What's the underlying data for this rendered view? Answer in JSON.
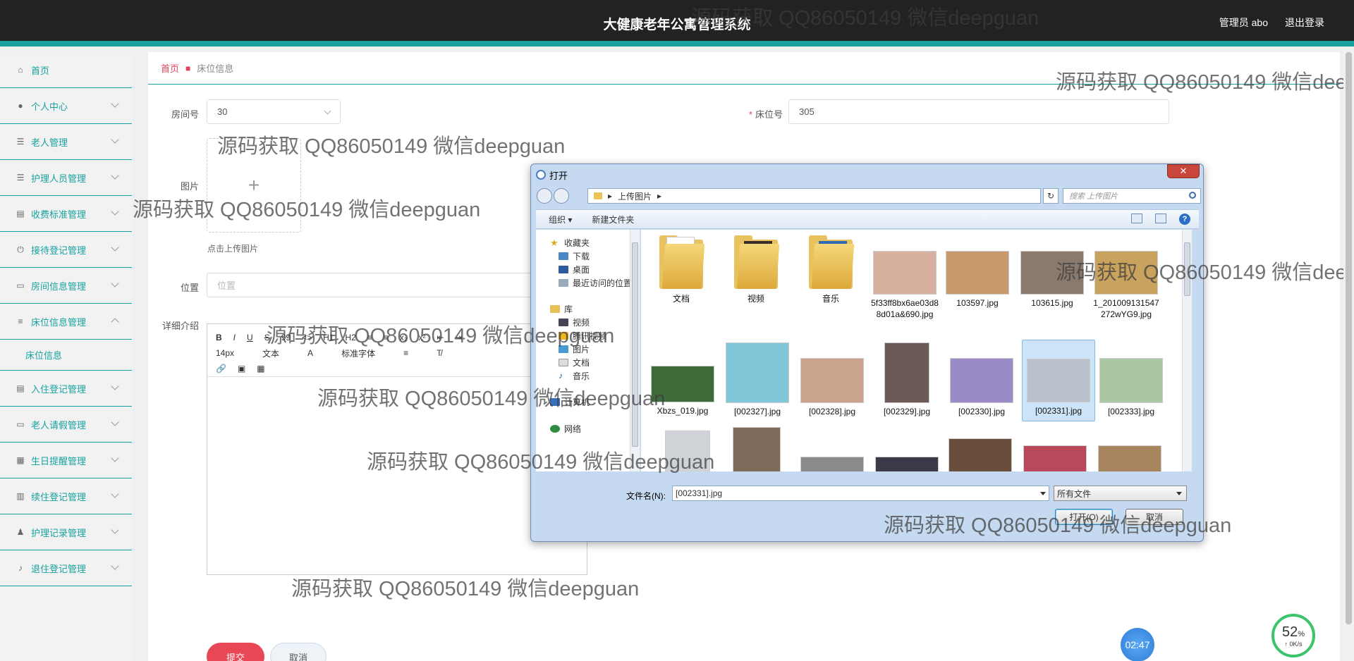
{
  "header": {
    "title": "大健康老年公寓管理系统",
    "user": "管理员 abo",
    "logout": "退出登录"
  },
  "sidebar": {
    "items": [
      {
        "label": "首页",
        "icon": "home-icon"
      },
      {
        "label": "个人中心",
        "icon": "user-icon"
      },
      {
        "label": "老人管理",
        "icon": "list-icon"
      },
      {
        "label": "护理人员管理",
        "icon": "list-icon"
      },
      {
        "label": "收费标准管理",
        "icon": "clipboard-icon"
      },
      {
        "label": "接待登记管理",
        "icon": "power-icon"
      },
      {
        "label": "房间信息管理",
        "icon": "monitor-icon"
      },
      {
        "label": "床位信息管理",
        "icon": "sliders-icon",
        "expanded": true
      },
      {
        "label": "入住登记管理",
        "icon": "clipboard-icon"
      },
      {
        "label": "老人请假管理",
        "icon": "monitor-icon"
      },
      {
        "label": "生日提醒管理",
        "icon": "grid-icon"
      },
      {
        "label": "续住登记管理",
        "icon": "bar-chart-icon"
      },
      {
        "label": "护理记录管理",
        "icon": "person-icon"
      },
      {
        "label": "退住登记管理",
        "icon": "mic-icon"
      }
    ],
    "sub": "床位信息"
  },
  "breadcrumb": {
    "home": "首页",
    "current": "床位信息"
  },
  "form": {
    "room_label": "房间号",
    "room_value": "30",
    "bed_label": "床位号",
    "bed_value": "305",
    "image_label": "图片",
    "upload_tip": "点击上传图片",
    "position_label": "位置",
    "position_placeholder": "位置",
    "detail_label": "详细介绍",
    "submit": "提交",
    "cancel": "取消"
  },
  "editor": {
    "row1": [
      "B",
      "I",
      "U",
      "S",
      "99",
      "<>",
      "H1",
      "H2",
      "≡",
      "≡",
      "x₂",
      "x²",
      "⇤",
      "⇥"
    ],
    "font_size": "14px",
    "text_style": "文本",
    "font_family": "标准字体"
  },
  "dialog": {
    "title": "打开",
    "path": "上传图片",
    "search_placeholder": "搜索 上传图片",
    "organize": "组织 ▾",
    "new_folder": "新建文件夹",
    "nav": [
      "收藏夹",
      "下载",
      "桌面",
      "最近访问的位置",
      "库",
      "视频",
      "腾讯视频",
      "图片",
      "文档",
      "音乐",
      "计算机",
      "网络"
    ],
    "files": [
      {
        "name": "文档",
        "kind": "folder"
      },
      {
        "name": "视频",
        "kind": "folder"
      },
      {
        "name": "音乐",
        "kind": "folder"
      },
      {
        "name": "5f33ff8bx6ae03d88d01a&690.jpg",
        "kind": "image",
        "color": "#d8b0a0"
      },
      {
        "name": "103597.jpg",
        "kind": "image",
        "color": "#c79a6c"
      },
      {
        "name": "103615.jpg",
        "kind": "image",
        "color": "#8a7a6e"
      },
      {
        "name": "1_201009131547272wYG9.jpg",
        "kind": "image",
        "color": "#c9a35e"
      },
      {
        "name": "Xbzs_019.jpg",
        "kind": "image",
        "color": "#3d6b3a"
      },
      {
        "name": "[002327].jpg",
        "kind": "image",
        "color": "#7fc7d9"
      },
      {
        "name": "[002328].jpg",
        "kind": "image",
        "color": "#caa38f"
      },
      {
        "name": "[002329].jpg",
        "kind": "image",
        "color": "#6b5a55"
      },
      {
        "name": "[002330].jpg",
        "kind": "image",
        "color": "#9a8ac5"
      },
      {
        "name": "[002331].jpg",
        "kind": "image",
        "color": "#b9c2cc",
        "selected": true
      },
      {
        "name": "[002333].jpg",
        "kind": "image",
        "color": "#a9c7a0"
      }
    ],
    "file_name_label": "文件名(N):",
    "file_name_value": "[002331].jpg",
    "file_type": "所有文件",
    "open": "打开(O)",
    "cancel": "取消"
  },
  "watermark": "源码获取 QQ86050149 微信deepguan",
  "widgets": {
    "timer": "02:47",
    "percent": "52",
    "percent_unit": "%",
    "rate": "↑ 0K/s"
  },
  "colors": {
    "accent": "#17a2a0",
    "danger": "#e84855",
    "topbar": "#222222"
  }
}
